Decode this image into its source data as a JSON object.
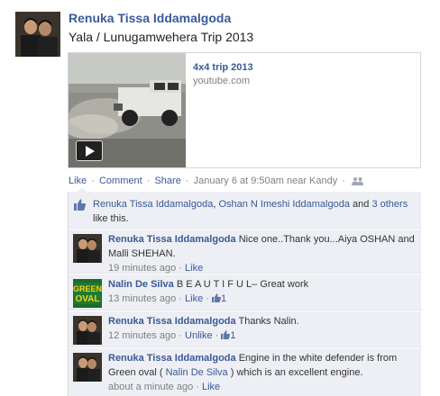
{
  "post": {
    "author": "Renuka Tissa Iddamalgoda",
    "message": "Yala / Lunugamwehera Trip 2013",
    "attachment": {
      "title": "4x4 trip 2013",
      "source": "youtube.com",
      "icon": "play-icon"
    },
    "actions": {
      "like": "Like",
      "sep1": "·",
      "comment": "Comment",
      "sep2": "·",
      "share": "Share",
      "sep3": "·",
      "timestamp": "January 6 at 9:50am near Kandy",
      "sep4": "·",
      "privacy_icon": "friends-icon"
    }
  },
  "likes": {
    "name1": "Renuka Tissa Iddamalgoda",
    "sep": ",",
    "name2": "Oshan N Imeshi Iddamalgoda",
    "and": "and",
    "others": "3 others",
    "suffix": "like this."
  },
  "comments": [
    {
      "author": "Renuka Tissa Iddamalgoda",
      "text": "Nice one..Thank you...Aiya OSHAN and Malli SHEHAN.",
      "time": "19 minutes ago",
      "sep": "·",
      "action": "Like"
    },
    {
      "author": "Nalin De Silva",
      "text": "B E A U T I F U L– Great work",
      "time": "13 minutes ago",
      "sep": "·",
      "action": "Like",
      "sep2": "·",
      "likes": "1",
      "avatar_text": "GREEN OVAL"
    },
    {
      "author": "Renuka Tissa Iddamalgoda",
      "text": "Thanks Nalin.",
      "time": "12 minutes ago",
      "sep": "·",
      "action": "Unlike",
      "sep2": "·",
      "likes": "1"
    },
    {
      "author": "Renuka Tissa Iddamalgoda",
      "text_before": "Engine in the white defender is from Green oval (",
      "mention": "Nalin De Silva",
      "text_after": ") which is an excellent engine.",
      "time": "about a minute ago",
      "sep": "·",
      "action": "Like"
    }
  ],
  "colors": {
    "link": "#3b5998",
    "meta": "#808080",
    "ufi_bg": "#edeff4"
  }
}
